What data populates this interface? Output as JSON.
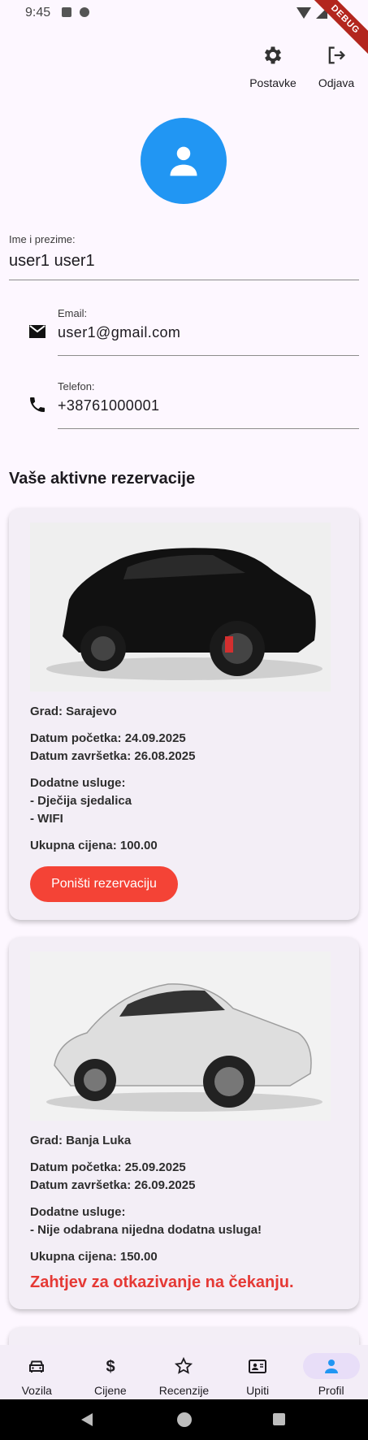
{
  "status_bar": {
    "time": "9:45",
    "debug_label": "DEBUG"
  },
  "top_actions": [
    {
      "label": "Postavke",
      "icon": "gear-icon"
    },
    {
      "label": "Odjava",
      "icon": "logout-icon"
    }
  ],
  "profile": {
    "name_label": "Ime i prezime:",
    "name_value": "user1 user1",
    "email_label": "Email:",
    "email_value": "user1@gmail.com",
    "phone_label": "Telefon:",
    "phone_value": "+38761000001"
  },
  "section_title": "Vaše aktivne rezervacije",
  "reservations": [
    {
      "city": "Grad: Sarajevo",
      "start": "Datum početka: 24.09.2025",
      "end": "Datum završetka: 26.08.2025",
      "services_title": "Dodatne usluge:",
      "services": [
        "- Dječija sjedalica",
        "- WIFI"
      ],
      "total": "Ukupna cijena: 100.00",
      "action_label": "Poništi rezervaciju",
      "car_color": "#111111"
    },
    {
      "city": "Grad: Banja Luka",
      "start": "Datum početka: 25.09.2025",
      "end": "Datum završetka: 26.09.2025",
      "services_title": "Dodatne usluge:",
      "services": [
        "- Nije odabrana nijedna dodatna usluga!"
      ],
      "total": "Ukupna cijena: 150.00",
      "pending_label": "Zahtjev za otkazivanje na čekanju.",
      "car_color": "#e6e6e6"
    }
  ],
  "bottom_nav": [
    {
      "label": "Vozila",
      "icon": "car-icon",
      "active": false
    },
    {
      "label": "Cijene",
      "icon": "dollar-icon",
      "active": false
    },
    {
      "label": "Recenzije",
      "icon": "star-icon",
      "active": false
    },
    {
      "label": "Upiti",
      "icon": "contact-card-icon",
      "active": false
    },
    {
      "label": "Profil",
      "icon": "person-icon",
      "active": true
    }
  ],
  "colors": {
    "accent": "#2196f3",
    "danger": "#f44336",
    "nav_active": "#e8def8",
    "background": "#fdf7ff"
  }
}
